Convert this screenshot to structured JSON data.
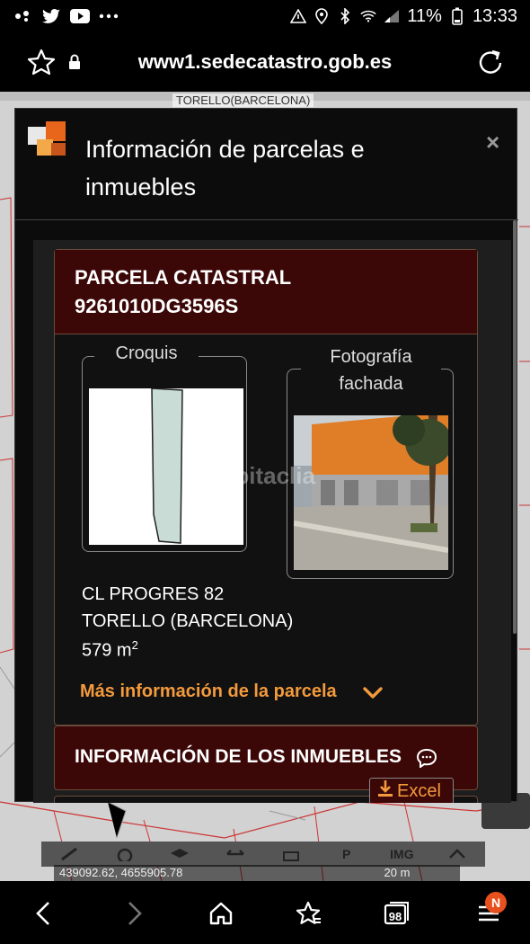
{
  "status_bar": {
    "battery": "11%",
    "time": "13:33",
    "left_icons": [
      "dots-icon",
      "twitter-icon",
      "youtube-icon",
      "more-icon"
    ],
    "right_icons": [
      "alert-icon",
      "location-icon",
      "bluetooth-icon",
      "wifi-icon",
      "signal-icon",
      "battery-icon"
    ]
  },
  "browser": {
    "url": "www1.sedecatastro.gob.es"
  },
  "map": {
    "town_label": "TORELLO(BARCELONA)",
    "coords": "439092.62, 4655905.78",
    "scale": "20 m",
    "tools": [
      "ruler-icon",
      "search-icon",
      "layers-icon",
      "arrows-icon",
      "print-icon",
      "P",
      "IMG",
      "share-icon"
    ]
  },
  "modal": {
    "title": "Información de parcelas e inmuebles",
    "close": "×",
    "parcel": {
      "heading": "PARCELA CATASTRAL",
      "reference": "9261010DG3596S",
      "croquis_label": "Croquis",
      "foto_label_1": "Fotografía",
      "foto_label_2": "fachada",
      "watermark": "habitaclia",
      "address_line1": "CL PROGRES 82",
      "address_line2": "TORELLO (BARCELONA)",
      "area_value": "579 m",
      "area_unit_sup": "2",
      "more_info": "Más información de la parcela"
    },
    "inmuebles": {
      "heading": "INFORMACIÓN DE LOS INMUEBLES",
      "excel_label": "Excel"
    }
  },
  "nav": {
    "tabs_count": "98",
    "badge": "N"
  },
  "colors": {
    "accent_orange": "#f39a3c",
    "header_red": "#3c0707",
    "badge_orange": "#e8501e"
  }
}
